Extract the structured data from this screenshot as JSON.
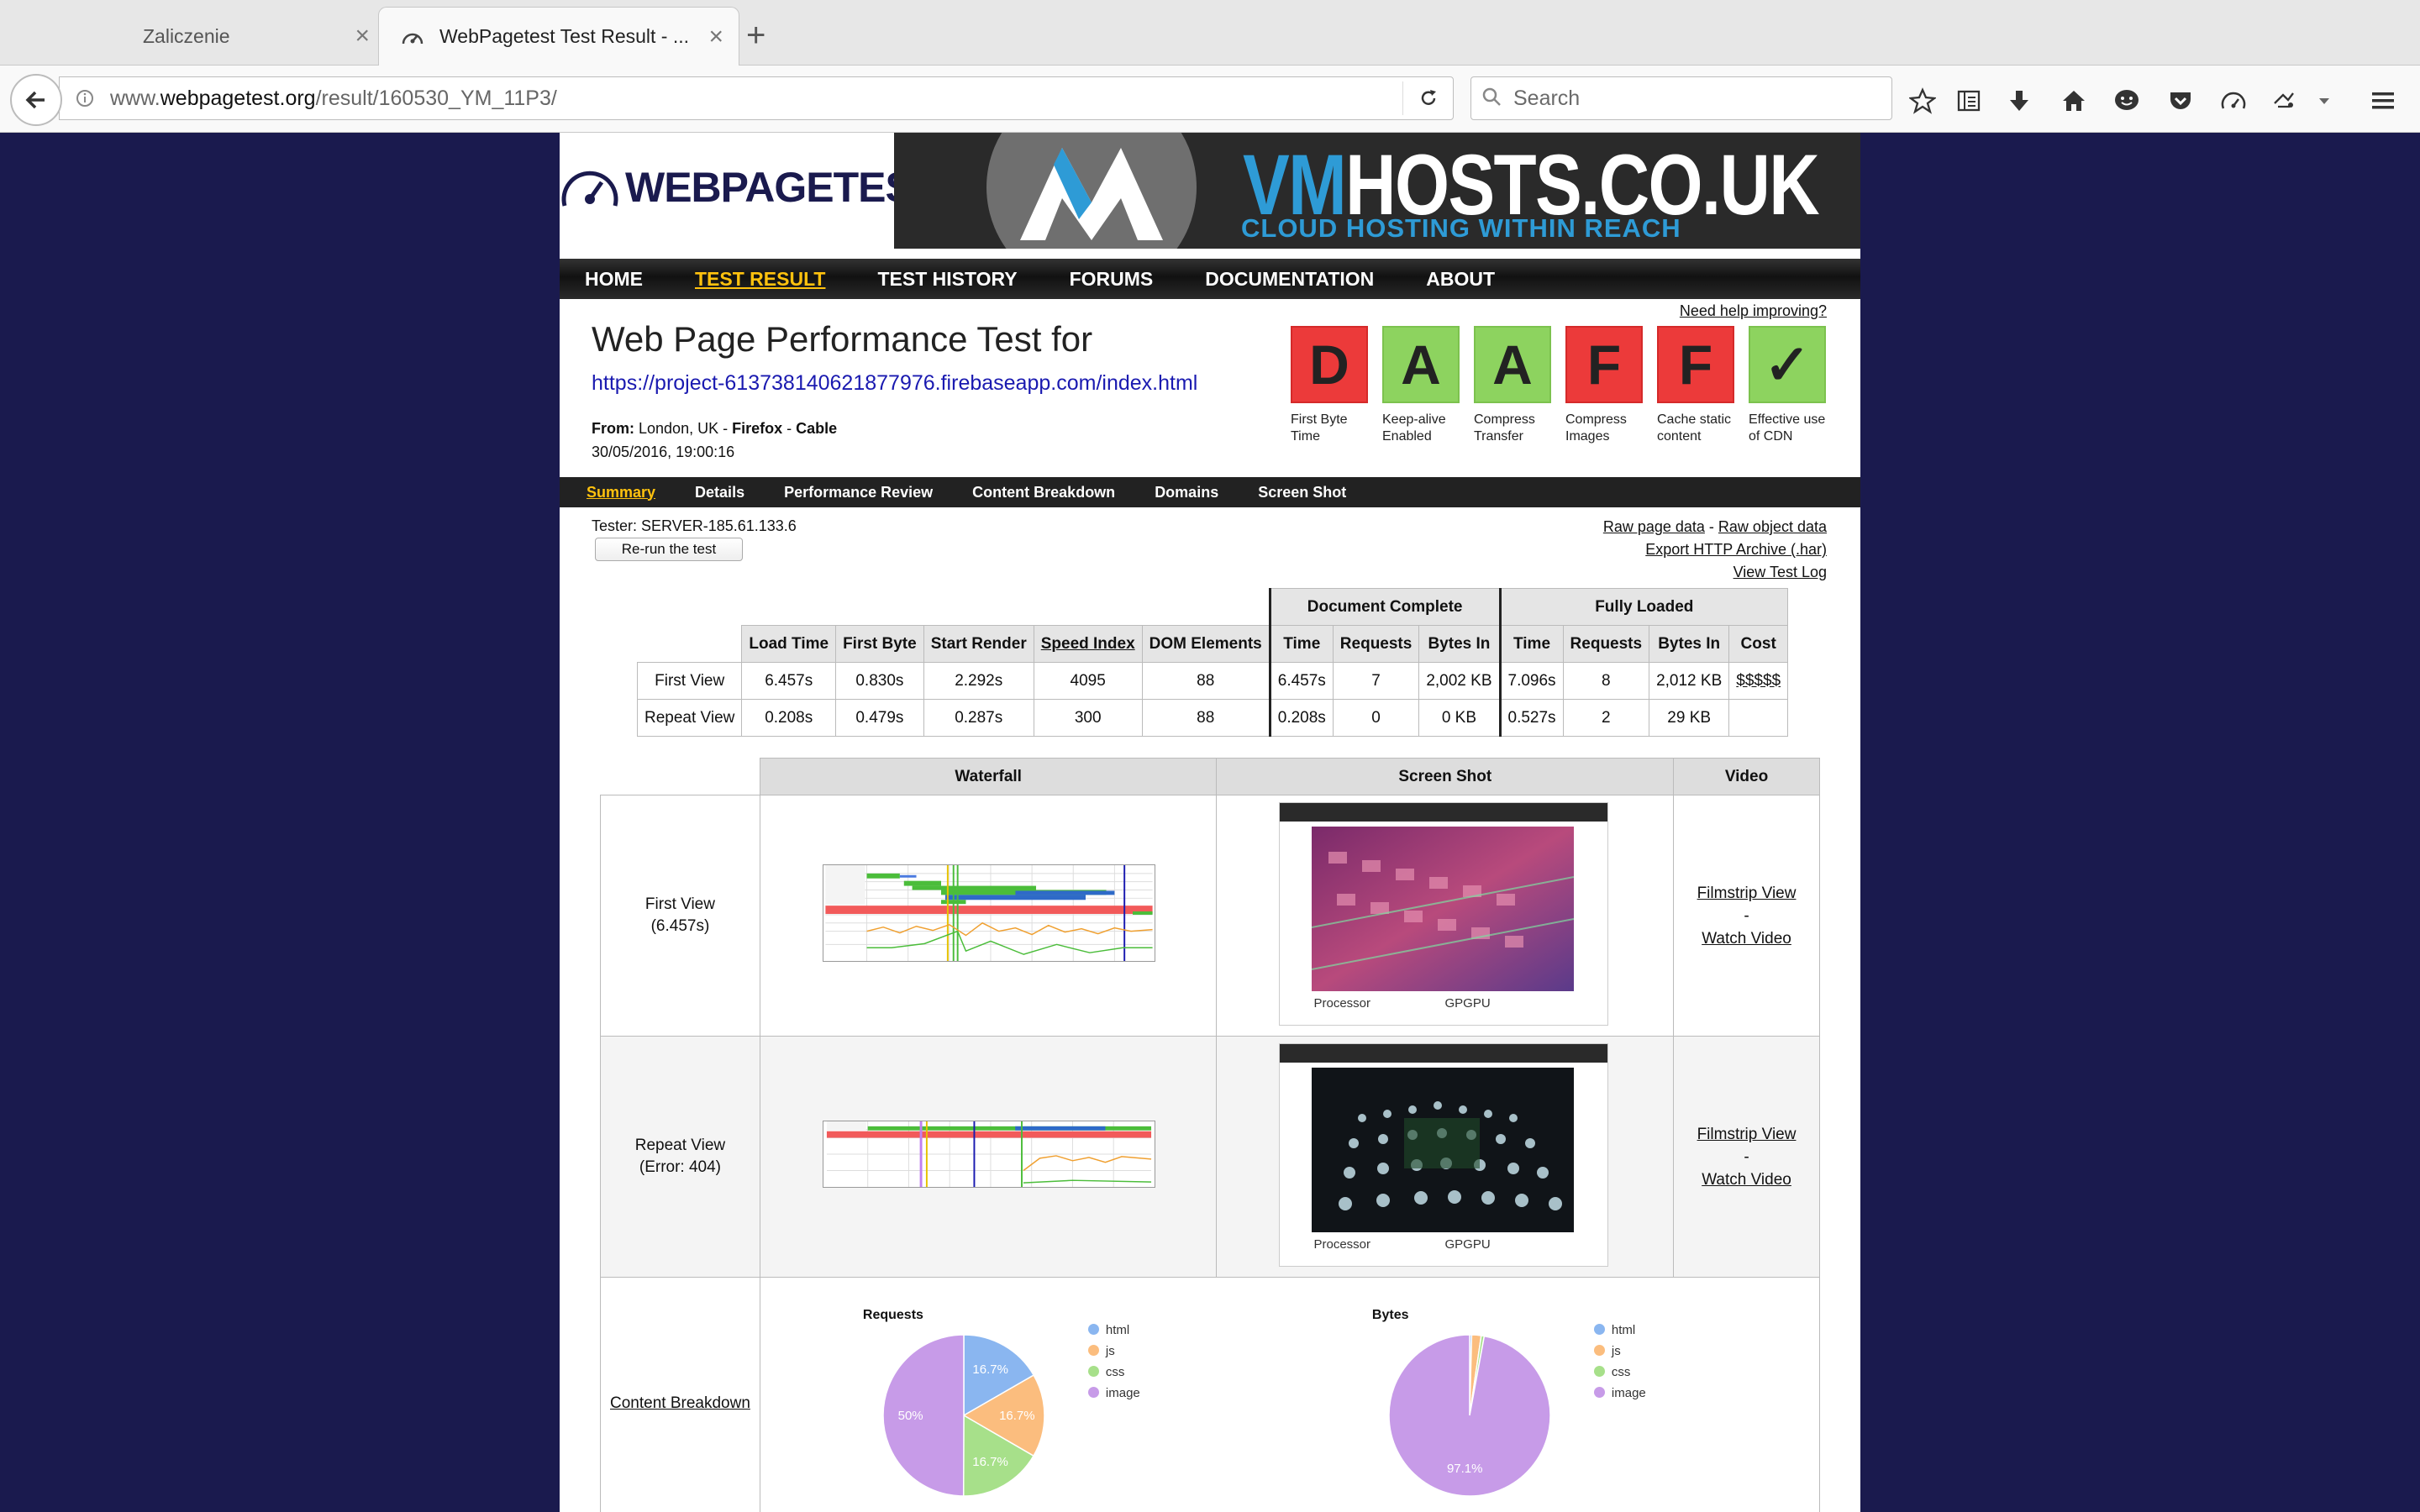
{
  "browser": {
    "tabs": [
      {
        "title": "Zaliczenie"
      },
      {
        "title": "WebPagetest Test Result - ..."
      }
    ],
    "url_prefix": "www.",
    "url_domain": "webpagetest.org",
    "url_path": "/result/160530_YM_11P3/",
    "search_placeholder": "Search"
  },
  "site": {
    "logo_text": "WEBPAGETEST",
    "ad": {
      "vm": "VM",
      "rest": "HOSTS.CO.UK",
      "tagline": "CLOUD HOSTING WITHIN REACH"
    },
    "nav": [
      "HOME",
      "TEST RESULT",
      "TEST HISTORY",
      "FORUMS",
      "DOCUMENTATION",
      "ABOUT"
    ]
  },
  "test": {
    "title": "Web Page Performance Test for",
    "url": "https://project-6137381406218779 76.firebaseapp.com/index.html",
    "from_label": "From:",
    "from_location": "London, UK - ",
    "browser": "Firefox",
    "sep": " - ",
    "connection": "Cable",
    "date": "30/05/2016, 19:00:16",
    "help": "Need help improving?",
    "grades": [
      {
        "letter": "D",
        "color": "red",
        "label": "First Byte Time"
      },
      {
        "letter": "A",
        "color": "green",
        "label": "Keep-alive Enabled"
      },
      {
        "letter": "A",
        "color": "green",
        "label": "Compress Transfer"
      },
      {
        "letter": "F",
        "color": "red",
        "label": "Compress Images"
      },
      {
        "letter": "F",
        "color": "red",
        "label": "Cache static content"
      },
      {
        "letter": "✓",
        "color": "green",
        "label": "Effective use of CDN"
      }
    ]
  },
  "subnav": [
    "Summary",
    "Details",
    "Performance Review",
    "Content Breakdown",
    "Domains",
    "Screen Shot"
  ],
  "tester": "Tester: SERVER-185.61.133.6",
  "rerun": "Re-run the test",
  "links": {
    "raw_page": "Raw page data",
    "dash": " - ",
    "raw_object": "Raw object data",
    "har": "Export HTTP Archive (.har)",
    "log": "View Test Log"
  },
  "results": {
    "group_doc": "Document Complete",
    "group_full": "Fully Loaded",
    "headers": [
      "Load Time",
      "First Byte",
      "Start Render",
      "Speed Index",
      "DOM Elements",
      "Time",
      "Requests",
      "Bytes In",
      "Time",
      "Requests",
      "Bytes In",
      "Cost"
    ],
    "rows": [
      {
        "label": "First View",
        "cells": [
          "6.457s",
          "0.830s",
          "2.292s",
          "4095",
          "88",
          "6.457s",
          "7",
          "2,002 KB",
          "7.096s",
          "8",
          "2,012 KB",
          "$$$$$"
        ]
      },
      {
        "label": "Repeat View",
        "cells": [
          "0.208s",
          "0.479s",
          "0.287s",
          "300",
          "88",
          "0.208s",
          "0",
          "0 KB",
          "0.527s",
          "2",
          "29 KB",
          ""
        ]
      }
    ]
  },
  "media": {
    "headers": [
      "Waterfall",
      "Screen Shot",
      "Video"
    ],
    "first_label": "First View",
    "first_sub": "(6.457s)",
    "repeat_label": "Repeat View",
    "repeat_sub": "(Error: 404)",
    "filmstrip": "Filmstrip View",
    "dash": "-",
    "watch": "Watch Video",
    "cap1": "Processor",
    "cap2": "GPGPU",
    "content_breakdown": "Content Breakdown"
  },
  "chart_data": [
    {
      "type": "pie",
      "title": "Requests",
      "categories": [
        "html",
        "js",
        "css",
        "image"
      ],
      "values": [
        16.7,
        16.7,
        16.7,
        50
      ],
      "labels": [
        "16.7%",
        "16.7%",
        "16.7%",
        "50%"
      ],
      "colors": [
        "#8ab6f0",
        "#fbbd7e",
        "#a7e08a",
        "#c79be8"
      ],
      "legend": "right"
    },
    {
      "type": "pie",
      "title": "Bytes",
      "categories": [
        "html",
        "js",
        "css",
        "image"
      ],
      "values": [
        0.4,
        1.9,
        0.6,
        97.1
      ],
      "labels": [
        "",
        "",
        "",
        "97.1%"
      ],
      "colors": [
        "#8ab6f0",
        "#fbbd7e",
        "#a7e08a",
        "#c79be8"
      ],
      "legend": "right"
    }
  ]
}
